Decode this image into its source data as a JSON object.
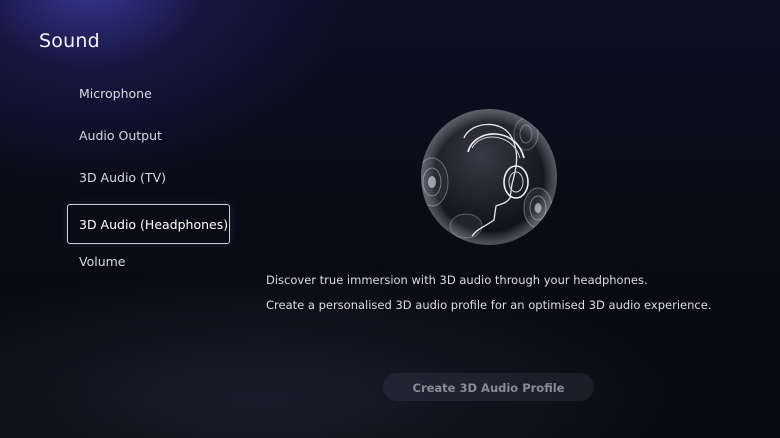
{
  "header": {
    "title": "Sound"
  },
  "menu": {
    "items": [
      {
        "label": "Microphone"
      },
      {
        "label": "Audio Output"
      },
      {
        "label": "3D Audio (TV)"
      },
      {
        "label": "3D Audio (Headphones)",
        "selected": true
      },
      {
        "label": "Volume"
      }
    ]
  },
  "main": {
    "illustration_icon": "headphones-sphere-icon",
    "description_line_1": "Discover true immersion with 3D audio through your headphones.",
    "description_line_2": "Create a personalised 3D audio profile for an optimised 3D audio experience.",
    "create_button_label": "Create 3D Audio Profile"
  },
  "colors": {
    "background": "#0b0b18",
    "accent_glow": "#4646be",
    "selected_border": "#cfcfe0",
    "button_disabled_text": "#8a8a98"
  }
}
